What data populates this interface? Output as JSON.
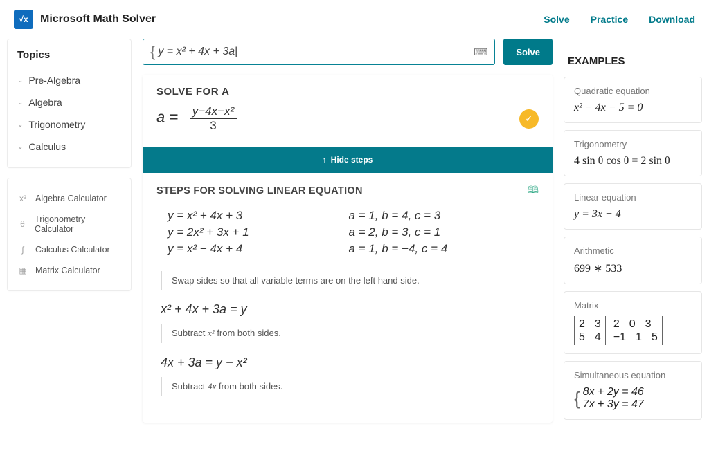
{
  "header": {
    "brand": "Microsoft Math Solver",
    "logo_glyph": "√x",
    "nav": {
      "solve": "Solve",
      "practice": "Practice",
      "download": "Download"
    }
  },
  "sidebar": {
    "topics_title": "Topics",
    "topics": [
      {
        "label": "Pre-Algebra"
      },
      {
        "label": "Algebra"
      },
      {
        "label": "Trigonometry"
      },
      {
        "label": "Calculus"
      }
    ],
    "tools": [
      {
        "icon": "x²",
        "label": "Algebra Calculator"
      },
      {
        "icon": "θ",
        "label": "Trigonometry Calculator"
      },
      {
        "icon": "∫",
        "label": "Calculus Calculator"
      },
      {
        "icon": "▦",
        "label": "Matrix Calculator"
      }
    ]
  },
  "input": {
    "equation": "y = x² + 4x + 3a",
    "cursor": "|"
  },
  "solve_button": "Solve",
  "solution": {
    "title": "SOLVE FOR A",
    "lhs": "a =",
    "numerator": "y−4x−x²",
    "denominator": "3",
    "check": "✓"
  },
  "hide_steps": "Hide steps",
  "steps": {
    "title": "STEPS FOR SOLVING LINEAR EQUATION",
    "system": [
      {
        "eq": "y = x² + 4x + 3",
        "abc": "a = 1, b = 4, c = 3"
      },
      {
        "eq": "y = 2x² + 3x + 1",
        "abc": "a = 2, b = 3, c = 1"
      },
      {
        "eq": "y = x² − 4x + 4",
        "abc": "a = 1, b = −4, c = 4"
      }
    ],
    "lines": [
      {
        "note": "Swap sides so that all variable terms are on the left hand side."
      },
      {
        "eq": "x² + 4x + 3a = y"
      },
      {
        "note": "Subtract x² from both sides."
      },
      {
        "eq": "4x + 3a = y − x²"
      },
      {
        "note": "Subtract 4x from both sides."
      }
    ]
  },
  "examples": {
    "title": "EXAMPLES",
    "items": [
      {
        "label": "Quadratic equation",
        "math": "x² − 4x − 5 = 0"
      },
      {
        "label": "Trigonometry",
        "math": "4 sin θ cos θ = 2 sin θ"
      },
      {
        "label": "Linear equation",
        "math": "y = 3x + 4"
      },
      {
        "label": "Arithmetic",
        "math": "699 ∗ 533"
      },
      {
        "label": "Matrix",
        "math": ""
      },
      {
        "label": "Simultaneous equation",
        "math": ""
      }
    ],
    "matrix": {
      "a": [
        [
          "2",
          "3"
        ],
        [
          "5",
          "4"
        ]
      ],
      "b": [
        [
          "2",
          "0",
          "3"
        ],
        [
          "−1",
          "1",
          "5"
        ]
      ]
    },
    "simultaneous": {
      "row1": "8x + 2y = 46",
      "row2": "7x + 3y = 47"
    }
  }
}
